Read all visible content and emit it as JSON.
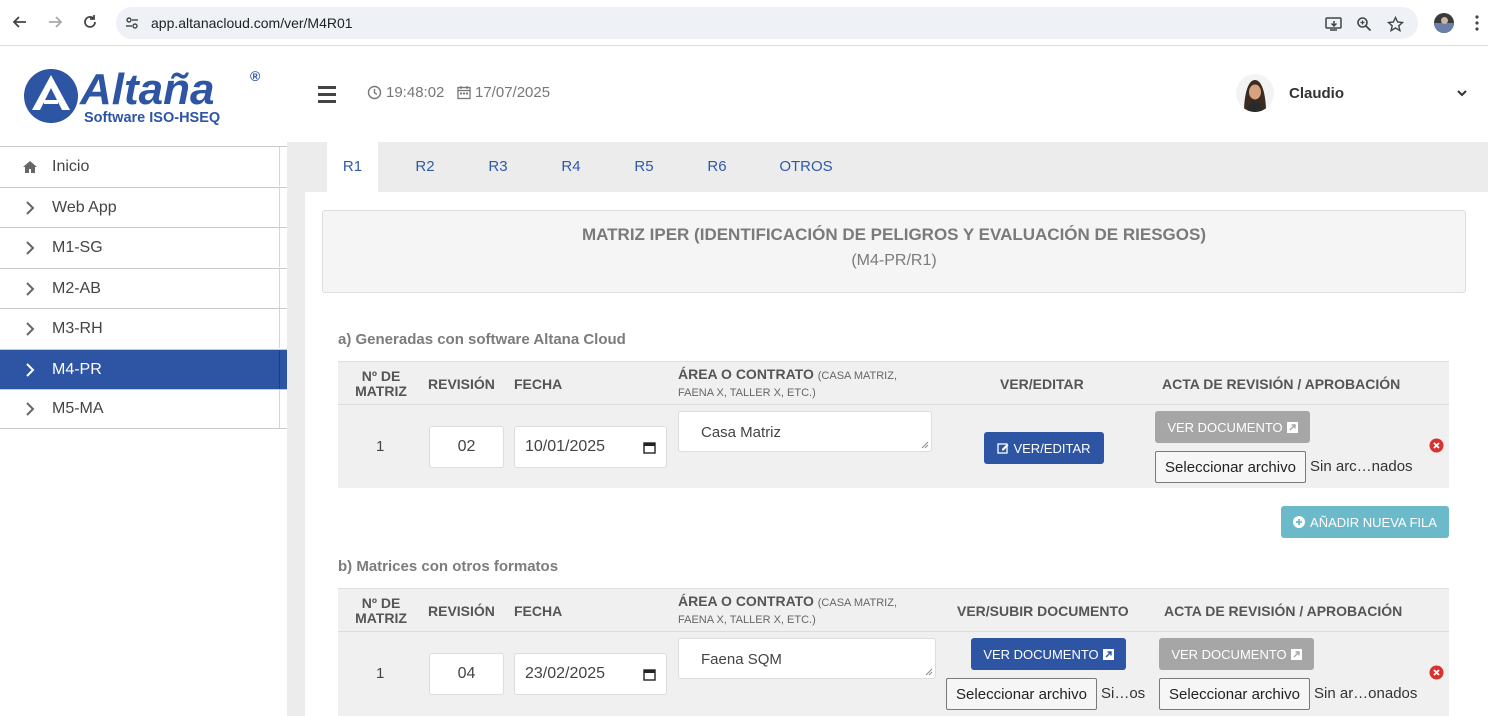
{
  "browser": {
    "url": "app.altanacloud.com/ver/M4R01"
  },
  "header": {
    "logo_text": "Altaña",
    "logo_subtext": "Software ISO-HSEQ",
    "time": "19:48:02",
    "date": "17/07/2025",
    "user_name": "Claudio"
  },
  "sidebar": {
    "items": [
      {
        "label": "Inicio",
        "icon": "home-icon"
      },
      {
        "label": "Web App",
        "icon": "chevron-right-icon"
      },
      {
        "label": "M1-SG",
        "icon": "chevron-right-icon"
      },
      {
        "label": "M2-AB",
        "icon": "chevron-right-icon"
      },
      {
        "label": "M3-RH",
        "icon": "chevron-right-icon"
      },
      {
        "label": "M4-PR",
        "icon": "chevron-right-icon",
        "active": true
      },
      {
        "label": "M5-MA",
        "icon": "chevron-right-icon"
      }
    ]
  },
  "tabs": [
    "R1",
    "R2",
    "R3",
    "R4",
    "R5",
    "R6",
    "OTROS"
  ],
  "active_tab": "R1",
  "page": {
    "title": "MATRIZ IPER (IDENTIFICACIÓN DE PELIGROS Y EVALUACIÓN DE RIESGOS)",
    "subtitle": "(M4-PR/R1)"
  },
  "section_a": {
    "title": "a) Generadas con software Altana Cloud",
    "headers": {
      "matriz": "Nº DE MATRIZ",
      "revision": "REVISIÓN",
      "fecha": "FECHA",
      "area": "ÁREA O CONTRATO",
      "area_hint": "(CASA MATRIZ, FAENA X, TALLER X, ETC.)",
      "ver": "VER/EDITAR",
      "acta": "ACTA DE REVISIÓN / APROBACIÓN"
    },
    "rows": [
      {
        "matriz": "1",
        "revision": "02",
        "fecha": "10/01/2025",
        "area": "Casa Matriz",
        "ver_label": "VER/EDITAR",
        "acta_doc_label": "VER DOCUMENTO",
        "file_button": "Seleccionar archivo",
        "file_status": "Sin arc…nados"
      }
    ],
    "add_row_label": "AÑADIR NUEVA FILA"
  },
  "section_b": {
    "title": "b) Matrices con otros formatos",
    "headers": {
      "matriz": "Nº DE MATRIZ",
      "revision": "REVISIÓN",
      "fecha": "FECHA",
      "area": "ÁREA O CONTRATO",
      "area_hint": "(CASA MATRIZ, FAENA X, TALLER X, ETC.)",
      "ver": "VER/SUBIR DOCUMENTO",
      "acta": "ACTA DE REVISIÓN / APROBACIÓN"
    },
    "rows": [
      {
        "matriz": "1",
        "revision": "04",
        "fecha": "23/02/2025",
        "area": "Faena SQM",
        "ver_doc_label": "VER DOCUMENTO",
        "ver_file_button": "Seleccionar archivo",
        "ver_file_status": "Si…os",
        "acta_doc_label": "VER DOCUMENTO",
        "file_button": "Seleccionar archivo",
        "file_status": "Sin ar…onados"
      }
    ]
  },
  "colors": {
    "primary": "#2e55a4",
    "teal": "#6cb9c9",
    "grey_button": "#a6a6a6",
    "danger": "#d9322e"
  }
}
